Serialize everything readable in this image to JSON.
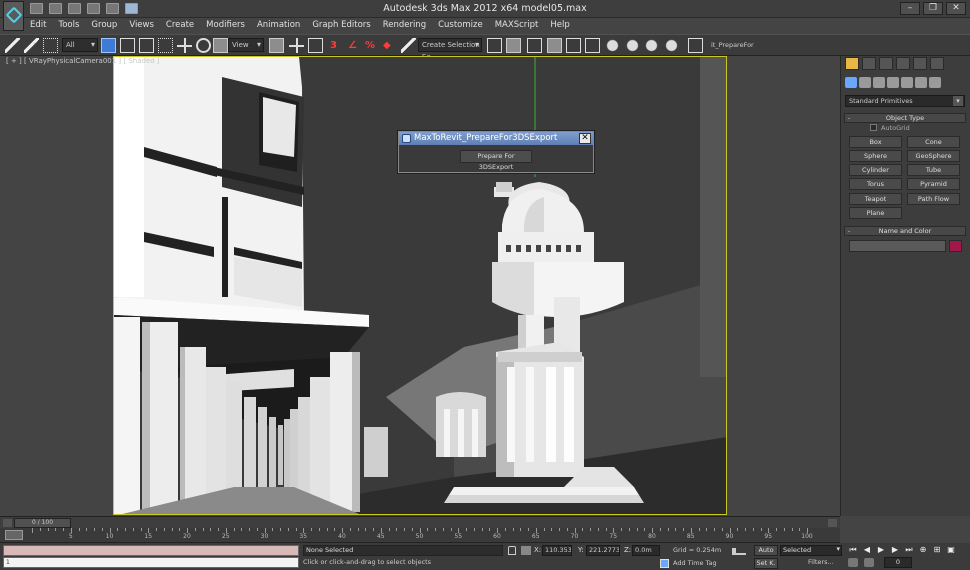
{
  "window": {
    "title": "Autodesk 3ds Max  2012 x64     model05.max",
    "controls": [
      "–",
      "❐",
      "✕"
    ]
  },
  "menu": [
    "Edit",
    "Tools",
    "Group",
    "Views",
    "Create",
    "Modifiers",
    "Animation",
    "Graph Editors",
    "Rendering",
    "Customize",
    "MAXScript",
    "Help"
  ],
  "toolbar": {
    "filter_value": "All",
    "refcoord_value": "View",
    "selection_set_placeholder": "Create Selection Se",
    "script_button_label": "it_PrepareFor"
  },
  "viewport": {
    "label": "[ + ] [ VRayPhysicalCamera001 ] [ Shaded ]",
    "active_border_color": "#c8c81e"
  },
  "dialog": {
    "title": "MaxToRevit_PrepareFor3DSExport",
    "close": "✕",
    "button": "Prepare For 3DSExport"
  },
  "command_panel": {
    "category": "Standard Primitives",
    "object_type_title": "Object Type",
    "autogrid": "AutoGrid",
    "buttons": [
      "Box",
      "Cone",
      "Sphere",
      "GeoSphere",
      "Cylinder",
      "Tube",
      "Torus",
      "Pyramid",
      "Teapot",
      "Path Flow",
      "Plane"
    ],
    "name_color_title": "Name and Color",
    "object_color": "#a0174a"
  },
  "timeline": {
    "frame_range": "0 / 100",
    "ticks": [
      "5",
      "10",
      "15",
      "20",
      "25",
      "30",
      "35",
      "40",
      "45",
      "50",
      "55",
      "60",
      "65",
      "70",
      "75",
      "80",
      "85",
      "90",
      "95",
      "100"
    ]
  },
  "status": {
    "selection": "None Selected",
    "prompt": "Click or click-and-drag to select objects",
    "maxscript_prompt": "1",
    "x_label": "X:",
    "x_value": "110.3537",
    "y_label": "Y:",
    "y_value": "221.27736",
    "z_label": "Z:",
    "z_value": "0.0m",
    "grid": "Grid = 0.254m",
    "add_time_tag": "Add Time Tag",
    "auto": "Auto",
    "set_key": "Set K.",
    "selected": "Selected",
    "filters": "Filters...",
    "frame": "0"
  }
}
